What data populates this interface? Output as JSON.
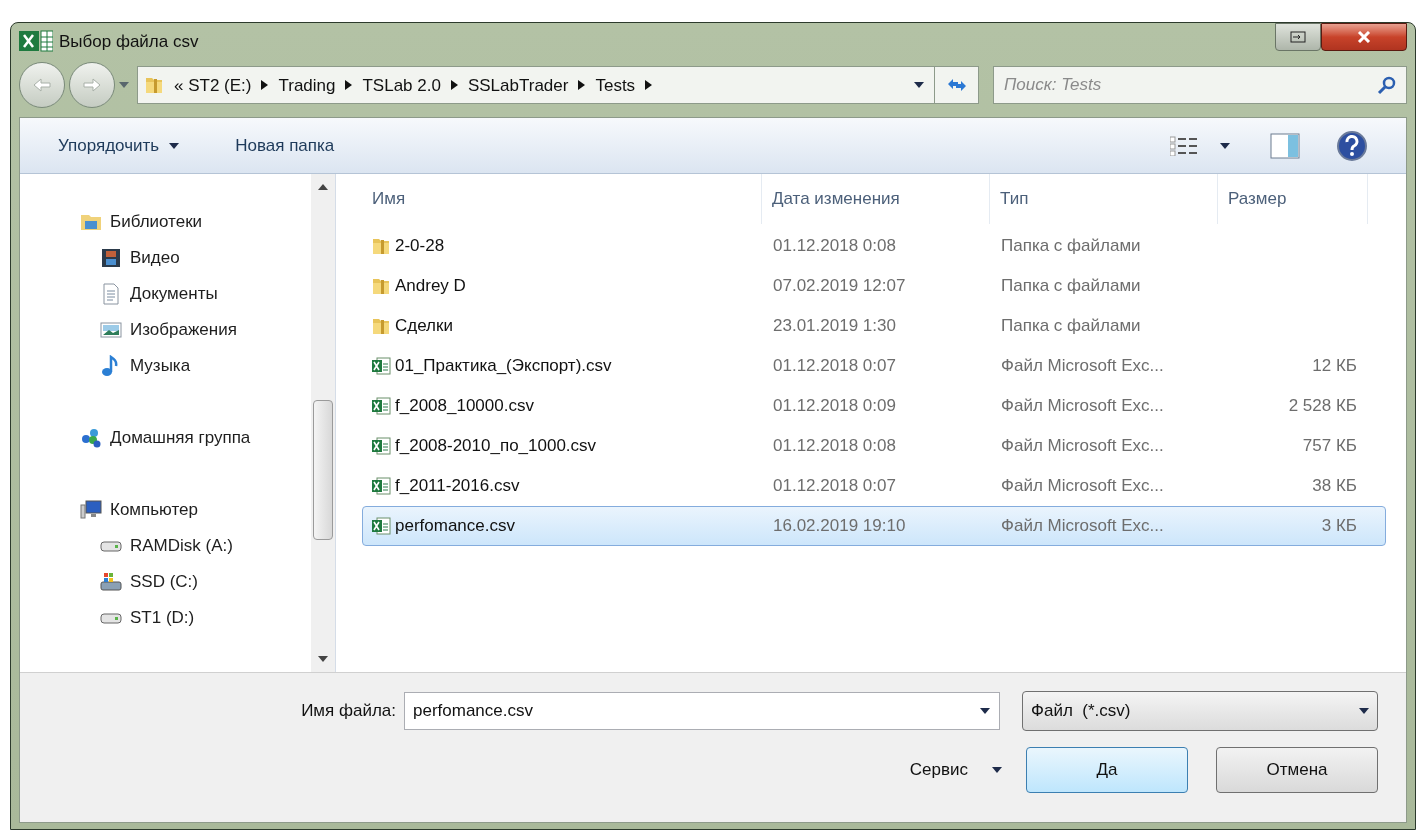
{
  "window": {
    "title": "Выбор файла csv"
  },
  "address": {
    "crumbs": [
      "« ST2 (E:)",
      "Trading",
      "TSLab 2.0",
      "SSLabTrader",
      "Tests"
    ]
  },
  "search": {
    "placeholder": "Поиск: Tests"
  },
  "toolbar": {
    "organize": "Упорядочить",
    "new_folder": "Новая папка"
  },
  "nav": [
    {
      "label": "Библиотеки",
      "kind": "library",
      "children": [
        {
          "label": "Видео",
          "kind": "video"
        },
        {
          "label": "Документы",
          "kind": "docs"
        },
        {
          "label": "Изображения",
          "kind": "images"
        },
        {
          "label": "Музыка",
          "kind": "music"
        }
      ]
    },
    {
      "label": "Домашняя группа",
      "kind": "homegroup"
    },
    {
      "label": "Компьютер",
      "kind": "computer",
      "children": [
        {
          "label": "RAMDisk (A:)",
          "kind": "drive"
        },
        {
          "label": "SSD (C:)",
          "kind": "windrive"
        },
        {
          "label": "ST1 (D:)",
          "kind": "drive"
        }
      ]
    }
  ],
  "table": {
    "columns": [
      "Имя",
      "Дата изменения",
      "Тип",
      "Размер"
    ],
    "rows": [
      {
        "kind": "folder",
        "name": "2-0-28",
        "date": "01.12.2018 0:08",
        "type": "Папка с файлами",
        "size": "",
        "selected": false
      },
      {
        "kind": "folder",
        "name": "Andrey D",
        "date": "07.02.2019 12:07",
        "type": "Папка с файлами",
        "size": "",
        "selected": false
      },
      {
        "kind": "folder",
        "name": "Сделки",
        "date": "23.01.2019 1:30",
        "type": "Папка с файлами",
        "size": "",
        "selected": false
      },
      {
        "kind": "excel",
        "name": "01_Практика_(Экспорт).csv",
        "date": "01.12.2018 0:07",
        "type": "Файл Microsoft Exc...",
        "size": "12 КБ",
        "selected": false
      },
      {
        "kind": "excel",
        "name": "f_2008_10000.csv",
        "date": "01.12.2018 0:09",
        "type": "Файл Microsoft Exc...",
        "size": "2 528 КБ",
        "selected": false
      },
      {
        "kind": "excel",
        "name": "f_2008-2010_по_1000.csv",
        "date": "01.12.2018 0:08",
        "type": "Файл Microsoft Exc...",
        "size": "757 КБ",
        "selected": false
      },
      {
        "kind": "excel",
        "name": "f_2011-2016.csv",
        "date": "01.12.2018 0:07",
        "type": "Файл Microsoft Exc...",
        "size": "38 КБ",
        "selected": false
      },
      {
        "kind": "excel",
        "name": "perfomance.csv",
        "date": "16.02.2019 19:10",
        "type": "Файл Microsoft Exc...",
        "size": "3 КБ",
        "selected": true
      }
    ]
  },
  "footer": {
    "filename_label": "Имя файла:",
    "filename": "perfomance.csv",
    "filter": "Файл  (*.csv)",
    "tools": "Сервис",
    "ok": "Да",
    "cancel": "Отмена"
  }
}
